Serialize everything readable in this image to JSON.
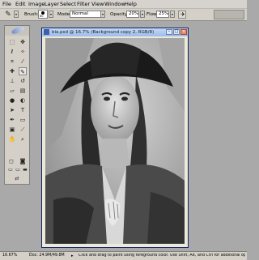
{
  "menu": [
    "File",
    "Edit",
    "Image",
    "Layer",
    "Select",
    "Filter",
    "View",
    "Window",
    "Help"
  ],
  "options": {
    "brush_label": "Brush:",
    "brush_size": "60",
    "mode_label": "Mode:",
    "mode_value": "Normal",
    "opacity_label": "Opacity:",
    "opacity_value": "20%",
    "flow_label": "Flow:",
    "flow_value": "25%"
  },
  "document": {
    "title": "bia.psd @ 16.7% (Background copy 2, RGB/8)"
  },
  "status": {
    "zoom": "16.67%",
    "doc_size": "Doc: 24.9M/49.8M",
    "hint": "Click and drag to paint using foreground color.  Use Shift, Alt, and Ctrl for additional options."
  },
  "colors": {
    "foreground": "#000000",
    "background": "#ffffff"
  }
}
